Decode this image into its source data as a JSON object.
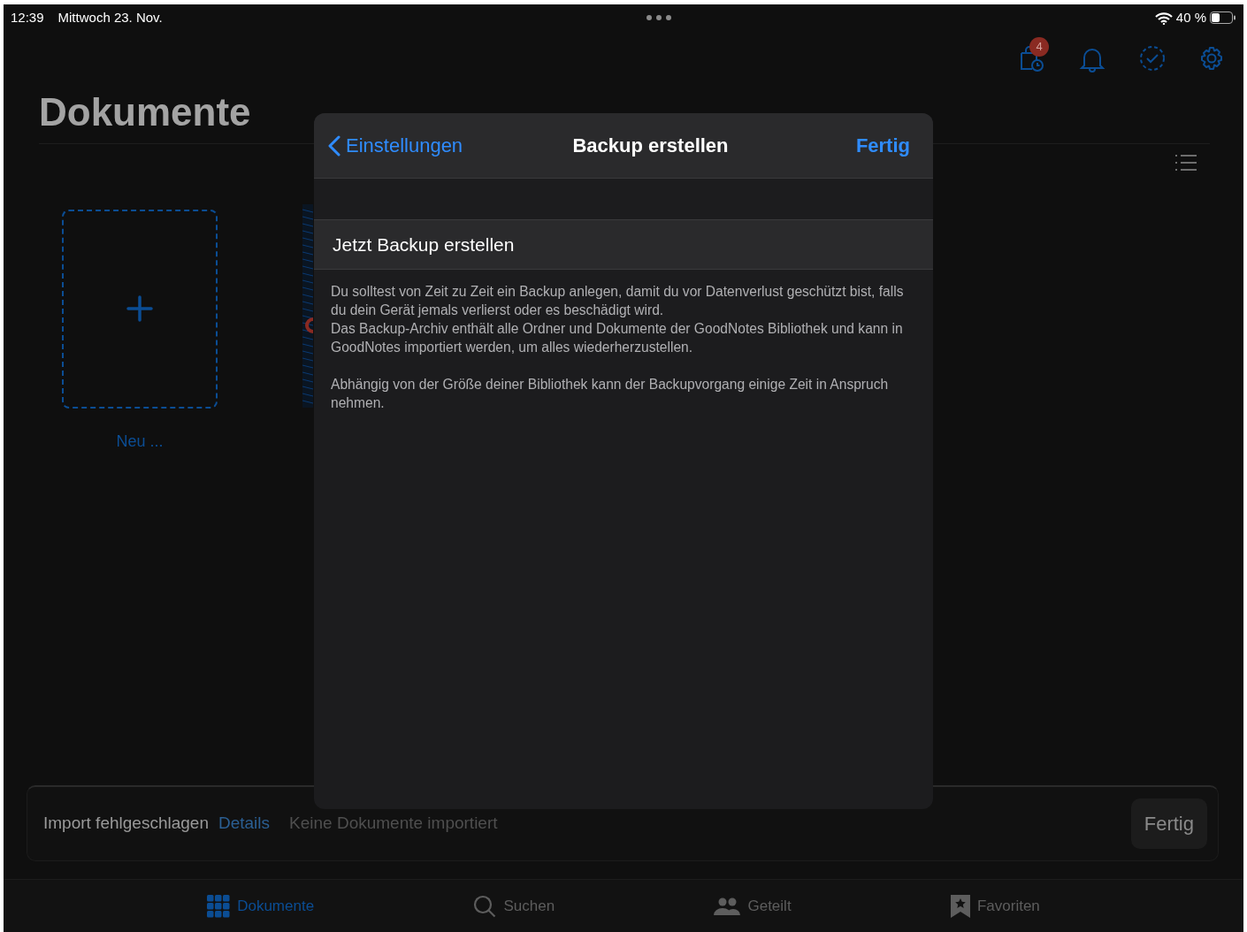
{
  "status_bar": {
    "time": "12:39",
    "date": "Mittwoch 23. Nov.",
    "battery": "40 %"
  },
  "toolbar": {
    "badge": "4"
  },
  "title": "Dokumente",
  "documents": [
    {
      "kind": "new",
      "label": "Neu ..."
    },
    {
      "kind": "document"
    }
  ],
  "import_banner": {
    "title": "Import fehlgeschlagen",
    "link": "Details",
    "message": "Keine Dokumente importiert",
    "button": "Fertig"
  },
  "tab_bar": [
    {
      "label": "Dokumente",
      "kind": "grid",
      "selected": true
    },
    {
      "label": "Suchen",
      "kind": "search",
      "selected": false
    },
    {
      "label": "Geteilt",
      "kind": "people",
      "selected": false
    },
    {
      "label": "Favoriten",
      "kind": "bookmark",
      "selected": false
    }
  ],
  "modal": {
    "back": "Einstellungen",
    "title": "Backup erstellen",
    "done": "Fertig",
    "action": "Jetzt Backup erstellen",
    "paragraphs": [
      "Du solltest von Zeit zu Zeit ein Backup anlegen, damit du vor Datenverlust geschützt bist, falls du dein Gerät jemals verlierst oder es beschädigt wird.\nDas Backup-Archiv enthält alle Ordner und Dokumente der GoodNotes Bibliothek und kann in GoodNotes importiert werden, um alles wiederherzustellen.",
      "Abhängig von der Größe deiner Bibliothek kann der Backupvorgang einige Zeit in Anspruch nehmen."
    ]
  }
}
